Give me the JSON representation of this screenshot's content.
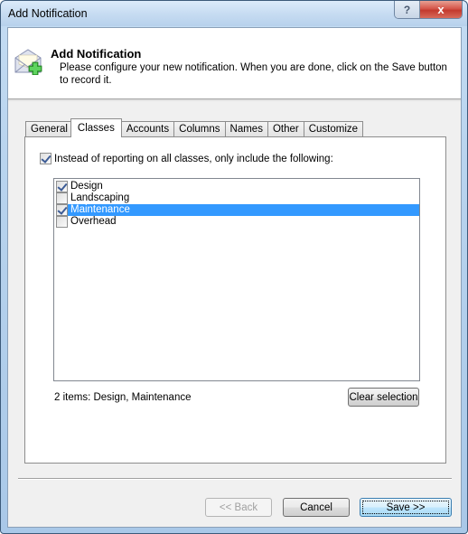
{
  "window": {
    "title": "Add Notification",
    "help_label": "?",
    "close_label": "x"
  },
  "header": {
    "icon": "envelope-add-icon",
    "title": "Add Notification",
    "description": "Please configure your new notification. When you are done, click on the Save button to record it."
  },
  "tabs": [
    {
      "label": "General",
      "active": false
    },
    {
      "label": "Classes",
      "active": true
    },
    {
      "label": "Accounts",
      "active": false
    },
    {
      "label": "Columns",
      "active": false
    },
    {
      "label": "Names",
      "active": false
    },
    {
      "label": "Other",
      "active": false
    },
    {
      "label": "Customize",
      "active": false
    }
  ],
  "classes_tab": {
    "include_checkbox": {
      "label": "Instead of reporting on all classes, only include the following:",
      "checked": true
    },
    "items": [
      {
        "label": "Design",
        "checked": true,
        "selected": false
      },
      {
        "label": "Landscaping",
        "checked": false,
        "selected": false
      },
      {
        "label": "Maintenance",
        "checked": true,
        "selected": true
      },
      {
        "label": "Overhead",
        "checked": false,
        "selected": false
      }
    ],
    "summary": "2 items: Design, Maintenance",
    "clear_button": "Clear selection"
  },
  "footer": {
    "back_label": "<< Back",
    "back_enabled": false,
    "cancel_label": "Cancel",
    "save_label": "Save >>"
  },
  "colors": {
    "selection": "#3399ff",
    "title_bar": "#c7dcf2",
    "close_button": "#c33a2e"
  }
}
